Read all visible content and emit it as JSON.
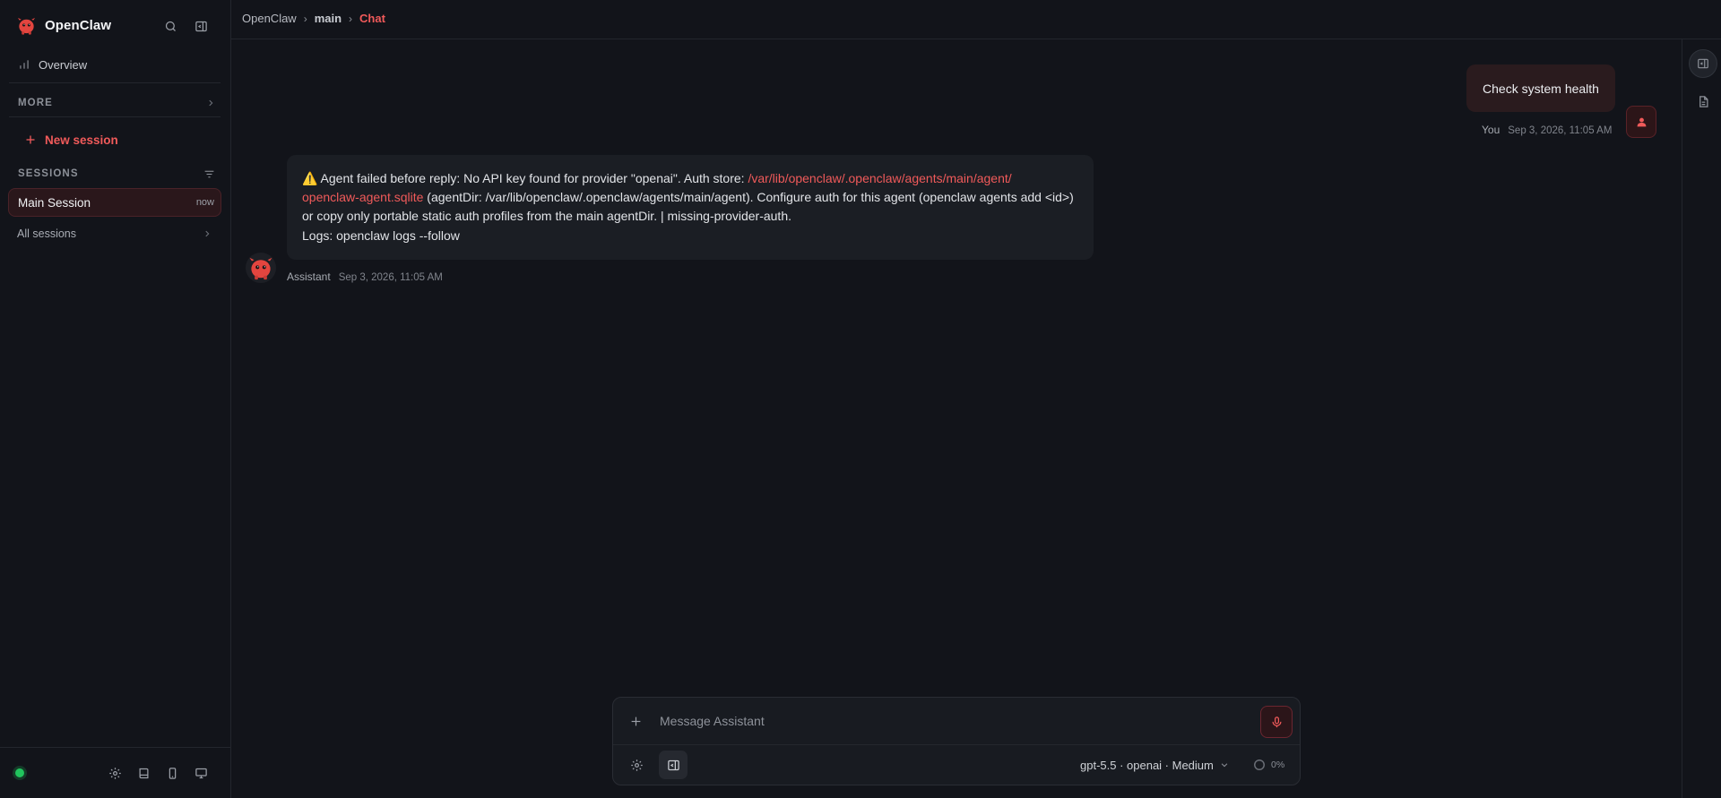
{
  "app": {
    "name": "OpenClaw"
  },
  "colors": {
    "accent": "#f05a5a",
    "status_online": "#21c45d",
    "background": "#12141a"
  },
  "sidebar": {
    "header_icons": [
      "search-icon",
      "sidebar-collapse-icon"
    ],
    "overview_label": "Overview",
    "more_label": "MORE",
    "new_session_label": "New session",
    "sessions_label": "SESSIONS",
    "sessions": [
      {
        "name": "Main Session",
        "time": "now",
        "active": true
      }
    ],
    "all_sessions_label": "All sessions",
    "footer_icons": [
      "settings-icon",
      "book-icon",
      "mobile-icon",
      "monitor-icon"
    ]
  },
  "breadcrumb": {
    "root": "OpenClaw",
    "agent": "main",
    "sep": "›",
    "current": "Chat"
  },
  "messages": [
    {
      "role": "user",
      "author": "You",
      "text": "Check system health",
      "time": "Sep 3, 2026, 11:05 AM"
    },
    {
      "role": "assistant",
      "author": "Assistant",
      "time": "Sep 3, 2026, 11:05 AM",
      "warning_icon": "⚠️",
      "text_prefix": " Agent failed before reply: No API key found for provider \"openai\". Auth store: ",
      "link_line1": "/var/lib/openclaw/.openclaw/agents/main/agent/",
      "link_line2": "openclaw-agent.sqlite",
      "text_mid": " (agentDir: /var/lib/openclaw/.openclaw/agents/main/agent). Configure auth for this agent (openclaw agents add <id>) or copy only portable static auth profiles from the main agentDir. | missing-provider-auth.",
      "logs_line": "Logs: openclaw logs --follow"
    }
  ],
  "composer": {
    "placeholder": "Message Assistant",
    "model_label": "gpt-5.5 · openai · Medium",
    "context_usage": "0%"
  }
}
